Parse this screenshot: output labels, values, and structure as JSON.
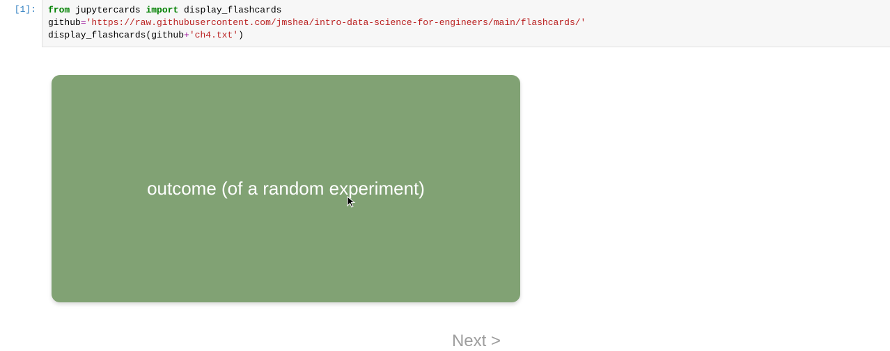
{
  "cell": {
    "prompt": "[1]:",
    "code": {
      "line1": {
        "from": "from",
        "module": " jupytercards ",
        "import": "import",
        "name": " display_flashcards"
      },
      "line2": {
        "var": "github",
        "eq": "=",
        "url": "'https://raw.githubusercontent.com/jmshea/intro-data-science-for-engineers/main/flashcards/'"
      },
      "line3": {
        "fn": "display_flashcards(github",
        "plus": "+",
        "file": "'ch4.txt'",
        "close": ")"
      }
    }
  },
  "flashcard": {
    "text": "outcome (of a random experiment)"
  },
  "next": {
    "label": "Next >"
  }
}
